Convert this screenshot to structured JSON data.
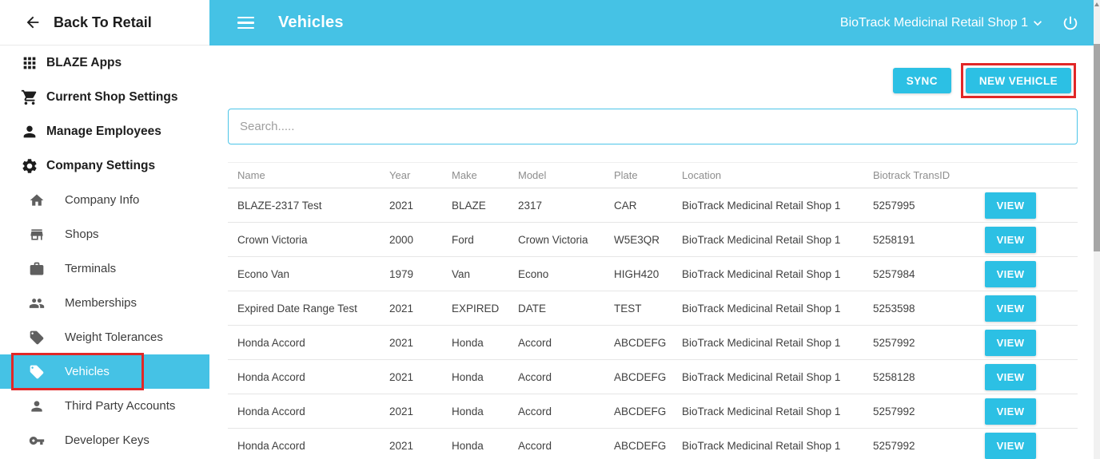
{
  "colors": {
    "accent_cyan": "#45c2e5",
    "button_cyan": "#2cc0e4",
    "highlight_red": "#e12727"
  },
  "sidebar": {
    "back_label": "Back To Retail",
    "items": [
      {
        "label": "BLAZE Apps",
        "icon": "apps-icon",
        "level": "main",
        "selected": false,
        "highlighted": false
      },
      {
        "label": "Current Shop Settings",
        "icon": "cart-icon",
        "level": "main",
        "selected": false,
        "highlighted": false
      },
      {
        "label": "Manage Employees",
        "icon": "person-icon",
        "level": "main",
        "selected": false,
        "highlighted": false
      },
      {
        "label": "Company Settings",
        "icon": "gear-icon",
        "level": "main",
        "selected": false,
        "highlighted": false
      },
      {
        "label": "Company Info",
        "icon": "home-icon",
        "level": "sub",
        "selected": false,
        "highlighted": false
      },
      {
        "label": "Shops",
        "icon": "store-icon",
        "level": "sub",
        "selected": false,
        "highlighted": false
      },
      {
        "label": "Terminals",
        "icon": "briefcase-icon",
        "level": "sub",
        "selected": false,
        "highlighted": false
      },
      {
        "label": "Memberships",
        "icon": "people-icon",
        "level": "sub",
        "selected": false,
        "highlighted": false
      },
      {
        "label": "Weight Tolerances",
        "icon": "tag-icon",
        "level": "sub",
        "selected": false,
        "highlighted": false
      },
      {
        "label": "Vehicles",
        "icon": "tag-icon",
        "level": "sub",
        "selected": true,
        "highlighted": true
      },
      {
        "label": "Third Party Accounts",
        "icon": "person-icon",
        "level": "sub",
        "selected": false,
        "highlighted": false
      },
      {
        "label": "Developer Keys",
        "icon": "key-icon",
        "level": "sub",
        "selected": false,
        "highlighted": false
      }
    ]
  },
  "topbar": {
    "title": "Vehicles",
    "shop_selector": "BioTrack Medicinal Retail Shop 1"
  },
  "toolbar": {
    "sync_label": "SYNC",
    "new_vehicle_label": "NEW VEHICLE"
  },
  "search": {
    "placeholder": "Search....."
  },
  "table": {
    "columns": [
      "Name",
      "Year",
      "Make",
      "Model",
      "Plate",
      "Location",
      "Biotrack TransID"
    ],
    "view_label": "VIEW",
    "rows": [
      [
        "BLAZE-2317 Test",
        "2021",
        "BLAZE",
        "2317",
        "CAR",
        "BioTrack Medicinal Retail Shop 1",
        "5257995"
      ],
      [
        "Crown Victoria",
        "2000",
        "Ford",
        "Crown Victoria",
        "W5E3QR",
        "BioTrack Medicinal Retail Shop 1",
        "5258191"
      ],
      [
        "Econo Van",
        "1979",
        "Van",
        "Econo",
        "HIGH420",
        "BioTrack Medicinal Retail Shop 1",
        "5257984"
      ],
      [
        "Expired Date Range Test",
        "2021",
        "EXPIRED",
        "DATE",
        "TEST",
        "BioTrack Medicinal Retail Shop 1",
        "5253598"
      ],
      [
        "Honda Accord",
        "2021",
        "Honda",
        "Accord",
        "ABCDEFG",
        "BioTrack Medicinal Retail Shop 1",
        "5257992"
      ],
      [
        "Honda Accord",
        "2021",
        "Honda",
        "Accord",
        "ABCDEFG",
        "BioTrack Medicinal Retail Shop 1",
        "5258128"
      ],
      [
        "Honda Accord",
        "2021",
        "Honda",
        "Accord",
        "ABCDEFG",
        "BioTrack Medicinal Retail Shop 1",
        "5257992"
      ],
      [
        "Honda Accord",
        "2021",
        "Honda",
        "Accord",
        "ABCDEFG",
        "BioTrack Medicinal Retail Shop 1",
        "5257992"
      ]
    ]
  }
}
